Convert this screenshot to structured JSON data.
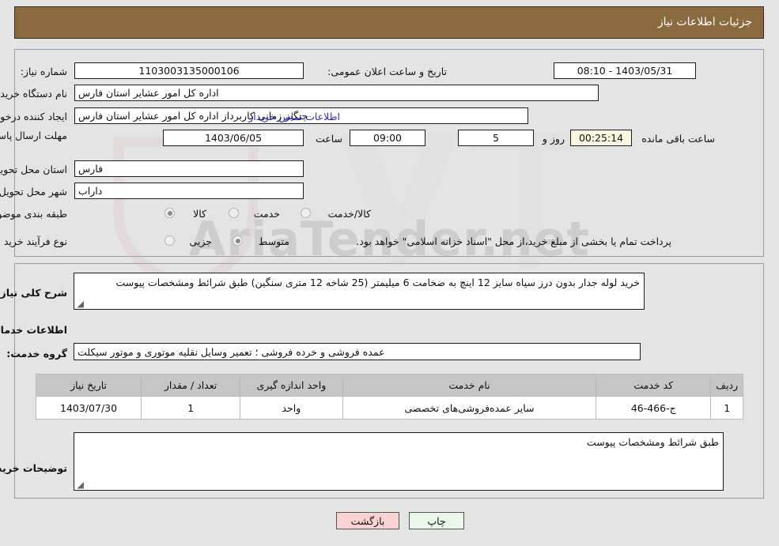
{
  "header": {
    "title": "جزئیات اطلاعات نیاز"
  },
  "watermark": {
    "text": "AriaTender.net"
  },
  "form": {
    "need_number_label": "شماره نیاز:",
    "need_number_value": "1103003135000106",
    "public_announce_label": "تاریخ و ساعت اعلان عمومی:",
    "public_announce_value": "1403/05/31 - 08:10",
    "buyer_org_label": "نام دستگاه خریدار:",
    "buyer_org_value": "اداره کل امور عشایر استان فارس",
    "requester_label": "ایجاد کننده درخواست:",
    "requester_value": "چنگیز زمانی کاربرداز اداره کل امور عشایر استان فارس",
    "contact_link": "اطلاعات تماس خریدار",
    "deadline_label": "مهلت ارسال پاسخ: تا تاریخ:",
    "deadline_date": "1403/06/05",
    "time_label": "ساعت",
    "time_value": "09:00",
    "days_value": "5",
    "days_and_label": "روز و",
    "countdown_value": "00:25:14",
    "remaining_label": "ساعت باقی مانده",
    "province_label": "استان محل تحویل:",
    "province_value": "فارس",
    "city_label": "شهر محل تحویل:",
    "city_value": "داراب",
    "category_label": "طبقه بندی موضوعی:",
    "category_options": [
      "کالا",
      "خدمت",
      "کالا/خدمت"
    ],
    "category_selected": 0,
    "process_label": "نوع فرآیند خرید :",
    "process_options": [
      "جزیی",
      "متوسط"
    ],
    "process_selected": 1,
    "payment_note": "پرداخت تمام یا بخشی از مبلغ خرید،از محل \"اسناد خزانه اسلامی\" خواهد بود."
  },
  "main": {
    "summary_label": "شرح کلی نیاز:",
    "summary_value": "خرید لوله جدار بدون درز سیاه سایز 12 اینچ به ضخامت 6 میلیمتر (25 شاخه  12 متری سنگین)  طبق شرائط ومشخصات پیوست",
    "section_title": "اطلاعات خدمات مورد نیاز",
    "service_group_label": "گروه خدمت:",
    "service_group_value": "عمده فروشی و خرده فروشی ؛ تعمیر وسایل نقلیه موتوری و موتور سیکلت",
    "buyer_notes_label": "توضیحات خریدار:",
    "buyer_notes_value": "طبق شرائط ومشخصات پیوست"
  },
  "table": {
    "columns": [
      "ردیف",
      "کد خدمت",
      "نام خدمت",
      "واحد اندازه گیری",
      "تعداد / مقدار",
      "تاریخ نیاز"
    ],
    "rows": [
      {
        "row": "1",
        "code": "ج-466-46",
        "name": "سایر عمده‌فروشی‌های تخصصی",
        "unit": "واحد",
        "qty": "1",
        "date": "1403/07/30"
      }
    ]
  },
  "buttons": {
    "print": "چاپ",
    "back": "بازگشت"
  },
  "colors": {
    "header_bg": "#8b6a40",
    "link": "#2a28cf",
    "print_btn": "#e8f7e8",
    "back_btn": "#fbd3d3",
    "countdown_bg": "#fbf8e0"
  }
}
